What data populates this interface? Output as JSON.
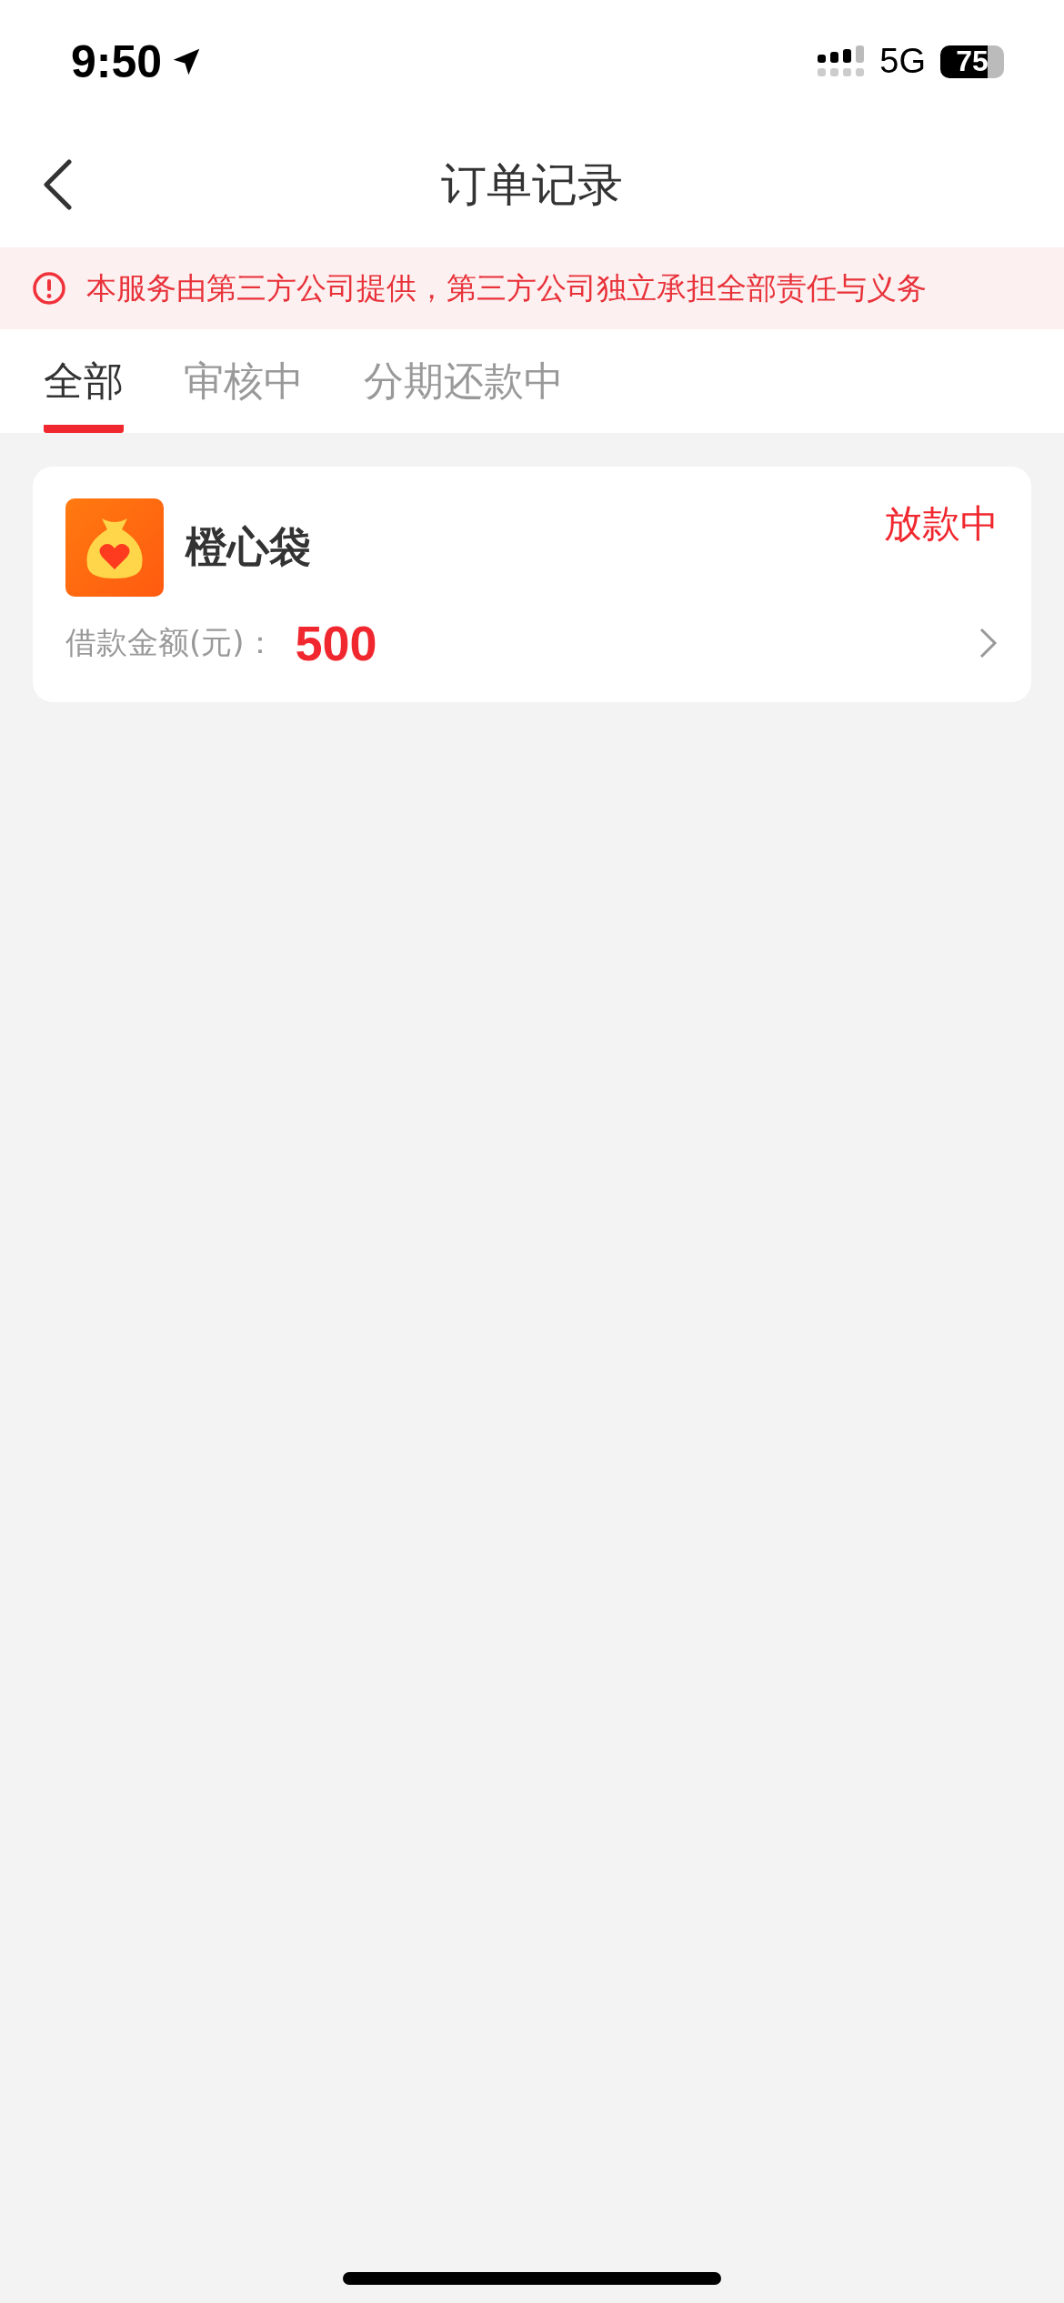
{
  "status_bar": {
    "time": "9:50",
    "network": "5G",
    "battery": "75"
  },
  "nav": {
    "title": "订单记录"
  },
  "notice": {
    "text": "本服务由第三方公司提供，第三方公司独立承担全部责任与义务"
  },
  "tabs": [
    {
      "label": "全部",
      "selected": true
    },
    {
      "label": "审核中",
      "selected": false
    },
    {
      "label": "分期还款中",
      "selected": false
    }
  ],
  "orders": [
    {
      "name": "橙心袋",
      "status": "放款中",
      "amount_label": "借款金额(元)：",
      "amount": "500"
    }
  ]
}
